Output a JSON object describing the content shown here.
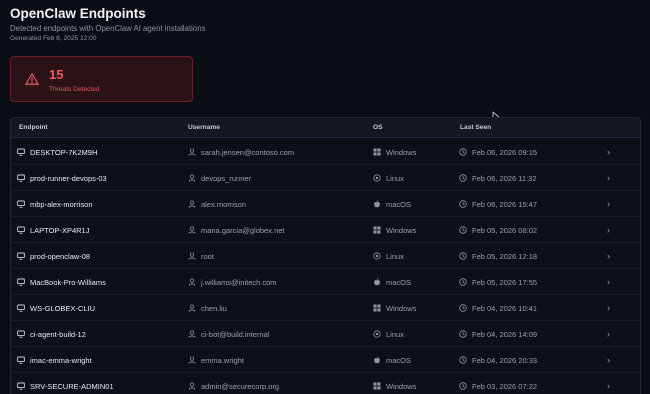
{
  "header": {
    "title": "OpenClaw Endpoints",
    "subtitle": "Detected endpoints with OpenClaw AI agent installations",
    "generated": "Generated Feb 8, 2025 12:00"
  },
  "summary": {
    "threat_count": "15",
    "threat_label": "Threats Detected",
    "accent_color": "#ef5a5f"
  },
  "table": {
    "columns": [
      "Endpoint",
      "Username",
      "OS",
      "Last Seen"
    ],
    "rows": [
      {
        "endpoint": "DESKTOP-7K2M9H",
        "username": "sarah.jensen@contoso.com",
        "os": "Windows",
        "os_icon": "windows-icon",
        "last_seen": "Feb 06, 2026 09:15"
      },
      {
        "endpoint": "prod-runner-devops-03",
        "username": "devops_runner",
        "os": "Linux",
        "os_icon": "linux-icon",
        "last_seen": "Feb 06, 2026 11:32"
      },
      {
        "endpoint": "mbp-alex-morrison",
        "username": "alex.morrison",
        "os": "macOS",
        "os_icon": "apple-icon",
        "last_seen": "Feb 06, 2026 15:47"
      },
      {
        "endpoint": "LAPTOP-XP4R1J",
        "username": "maria.garcia@globex.net",
        "os": "Windows",
        "os_icon": "windows-icon",
        "last_seen": "Feb 05, 2026 08:02"
      },
      {
        "endpoint": "prod-openclaw-08",
        "username": "root",
        "os": "Linux",
        "os_icon": "linux-icon",
        "last_seen": "Feb 05, 2026 12:18"
      },
      {
        "endpoint": "MacBook-Pro-Williams",
        "username": "j.williams@initech.com",
        "os": "macOS",
        "os_icon": "apple-icon",
        "last_seen": "Feb 05, 2026 17:55"
      },
      {
        "endpoint": "WS-GLOBEX-CLIU",
        "username": "chen.liu",
        "os": "Windows",
        "os_icon": "windows-icon",
        "last_seen": "Feb 04, 2026 10:41"
      },
      {
        "endpoint": "ci-agent-build-12",
        "username": "ci-bot@build.internal",
        "os": "Linux",
        "os_icon": "linux-icon",
        "last_seen": "Feb 04, 2026 14:09"
      },
      {
        "endpoint": "imac-emma-wright",
        "username": "emma.wright",
        "os": "macOS",
        "os_icon": "apple-icon",
        "last_seen": "Feb 04, 2026 20:33"
      },
      {
        "endpoint": "SRV-SECURE-ADMIN01",
        "username": "admin@securecorp.org",
        "os": "Windows",
        "os_icon": "windows-icon",
        "last_seen": "Feb 03, 2026 07:22"
      }
    ]
  }
}
